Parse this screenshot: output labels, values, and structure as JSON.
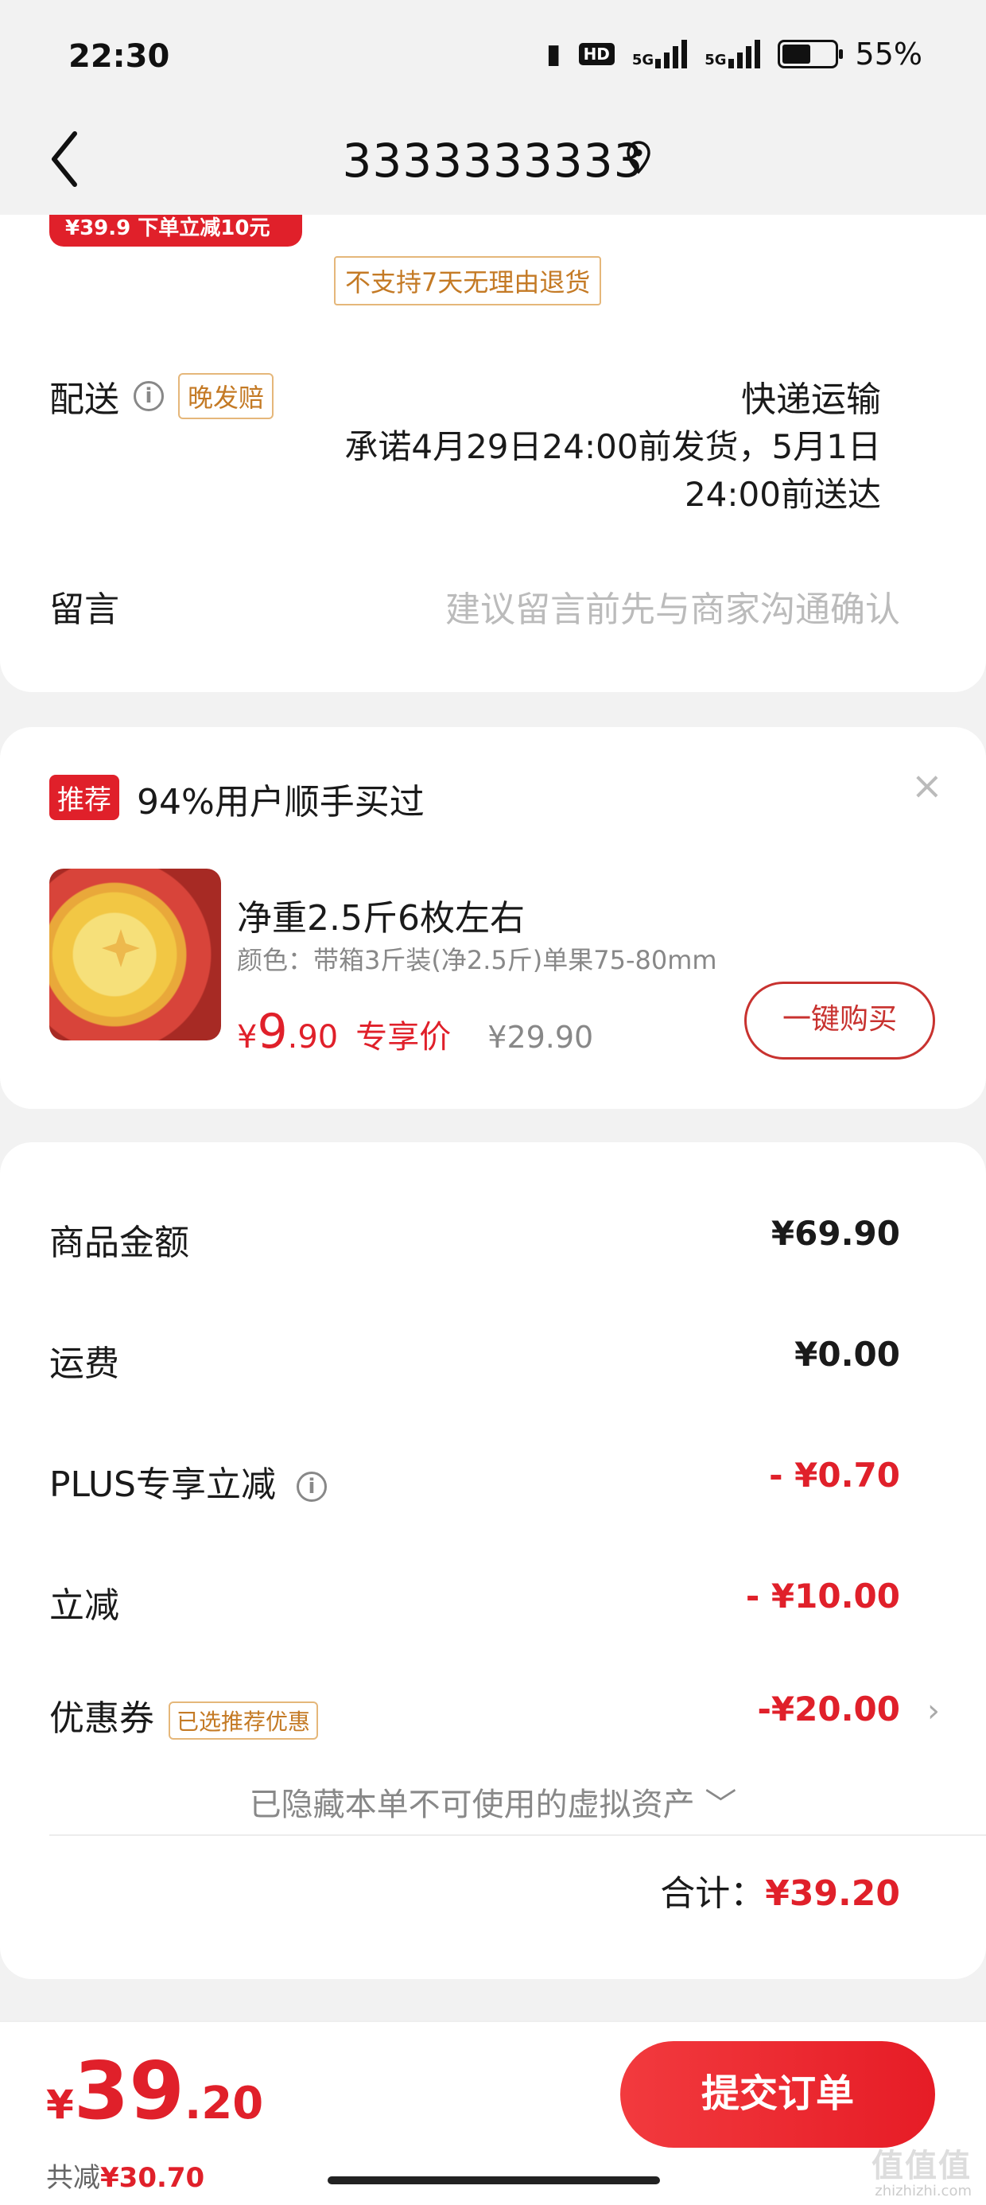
{
  "status_bar": {
    "time": "22:30",
    "battery": "55%",
    "battery_level": 0.55,
    "net1": "5G",
    "net2": "5G",
    "hd": "HD"
  },
  "header": {
    "title": "3333333333"
  },
  "order": {
    "promo_strip": "¥39.9 下单立减10元",
    "no_return_tag": "不支持7天无理由退货",
    "delivery_label": "配送",
    "late_compensation_tag": "晚发赔",
    "delivery_method": "快递运输",
    "delivery_promise": "承诺4月29日24:00前发货，5月1日24:00前送达",
    "message_label": "留言",
    "message_placeholder": "建议留言前先与商家沟通确认"
  },
  "recommend": {
    "tag": "推荐",
    "title": "94%用户顺手买过",
    "close": "×",
    "product_name": "净重2.5斤6枚左右",
    "product_spec": "颜色：带箱3斤装(净2.5斤)单果75-80mm",
    "price_currency": "¥",
    "price_int": "9",
    "price_dec": ".90",
    "price_label": "专享价",
    "original_price": "¥29.90",
    "buy_button": "一键购买"
  },
  "summary": {
    "goods_label": "商品金额",
    "goods_value": "¥69.90",
    "shipping_label": "运费",
    "shipping_value": "¥0.00",
    "plus_label": "PLUS专享立减",
    "plus_value": "- ¥0.70",
    "instant_label": "立减",
    "instant_value": "- ¥10.00",
    "coupon_label": "优惠券",
    "coupon_tag": "已选推荐优惠",
    "coupon_value": "-¥20.00",
    "hidden_assets_note": "已隐藏本单不可使用的虚拟资产 ﹀",
    "total_label": "合计：",
    "total_value": "¥39.20"
  },
  "bottom_bar": {
    "currency": "¥",
    "price_int": "39",
    "price_dec": ".20",
    "saved_label": "共减",
    "saved_value": "¥30.70",
    "submit_button": "提交订单"
  },
  "watermark": {
    "main": "值值值",
    "sub": "zhizhizhi.com"
  },
  "colors": {
    "accent_red": "#e0202a",
    "tag_gold": "#c47a25",
    "background": "#f2f2f2"
  }
}
